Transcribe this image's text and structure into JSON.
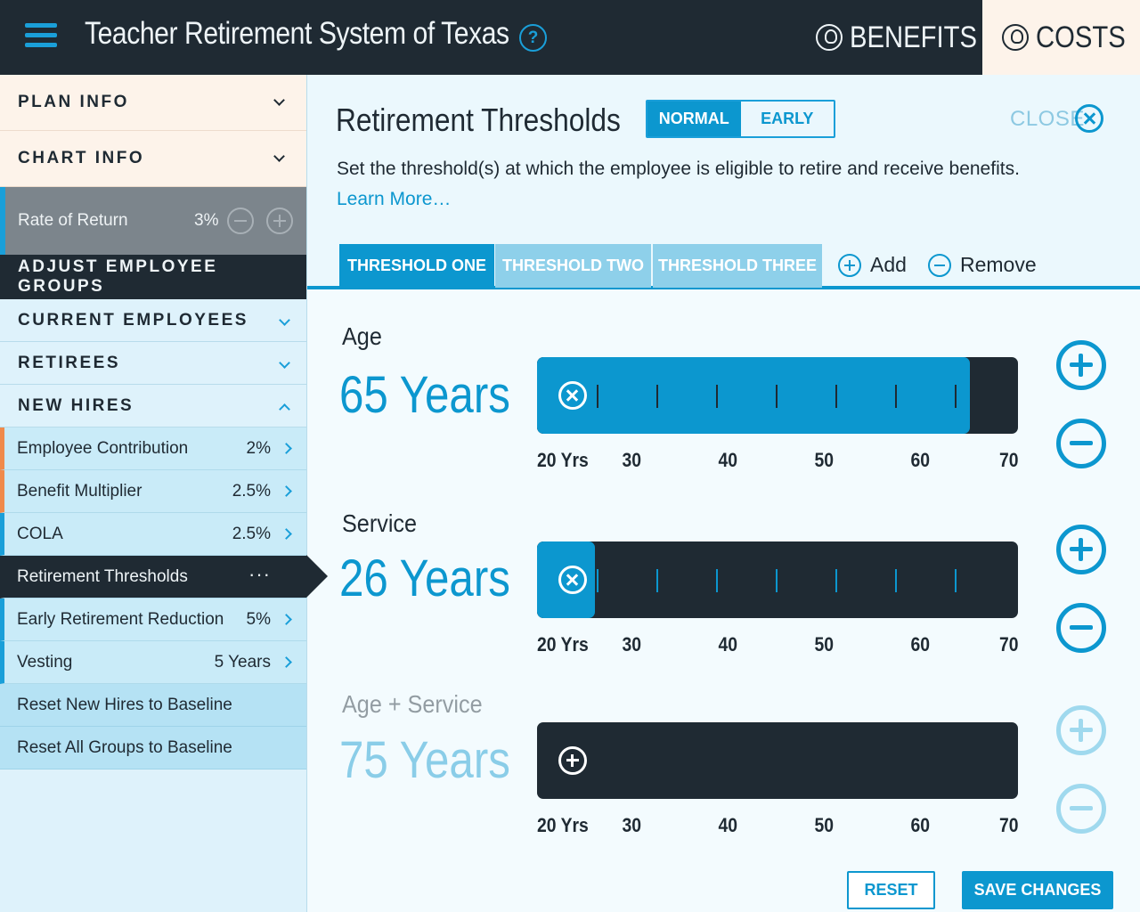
{
  "header": {
    "title": "Teacher Retirement System of Texas",
    "help_label": "?",
    "benefits_label": "BENEFITS",
    "costs_label": "COSTS"
  },
  "sidebar": {
    "plan_info": "PLAN INFO",
    "chart_info": "CHART INFO",
    "rate_of_return": {
      "label": "Rate of Return",
      "value": "3%"
    },
    "adjust_groups": "ADJUST EMPLOYEE GROUPS",
    "groups": [
      {
        "label": "CURRENT EMPLOYEES"
      },
      {
        "label": "RETIREES"
      },
      {
        "label": "NEW HIRES"
      }
    ],
    "items": [
      {
        "label": "Employee Contribution",
        "value": "2%"
      },
      {
        "label": "Benefit Multiplier",
        "value": "2.5%"
      },
      {
        "label": "COLA",
        "value": "2.5%"
      },
      {
        "label": "Retirement Thresholds",
        "value": "···"
      },
      {
        "label": "Early Retirement Reduction",
        "value": "5%"
      },
      {
        "label": "Vesting",
        "value": "5 Years"
      }
    ],
    "reset_new_hires": "Reset New Hires to Baseline",
    "reset_all": "Reset All Groups to Baseline"
  },
  "panel": {
    "title": "Retirement Thresholds",
    "toggle": {
      "normal": "NORMAL",
      "early": "EARLY"
    },
    "close_label": "CLOSE",
    "description": "Set the threshold(s) at which the employee is eligible to retire and receive benefits.",
    "learn_more": "Learn More…",
    "tabs": [
      "THRESHOLD ONE",
      "THRESHOLD TWO",
      "THRESHOLD THREE"
    ],
    "add_label": "Add",
    "remove_label": "Remove",
    "axis_labels": [
      "20 Yrs",
      "30",
      "40",
      "50",
      "60",
      "70"
    ],
    "axis_range": [
      20,
      70
    ],
    "thresholds": [
      {
        "label": "Age",
        "value_text": "65 Years",
        "value": 65,
        "enabled": true
      },
      {
        "label": "Service",
        "value_text": "26 Years",
        "value": 26,
        "enabled": true
      },
      {
        "label": "Age + Service",
        "value_text": "75 Years",
        "value": 75,
        "enabled": false
      }
    ],
    "reset_label": "RESET",
    "save_label": "SAVE CHANGES"
  },
  "colors": {
    "accent": "#0c97cf",
    "dark": "#1f2a33",
    "orange_marker": "#f08a4b"
  }
}
